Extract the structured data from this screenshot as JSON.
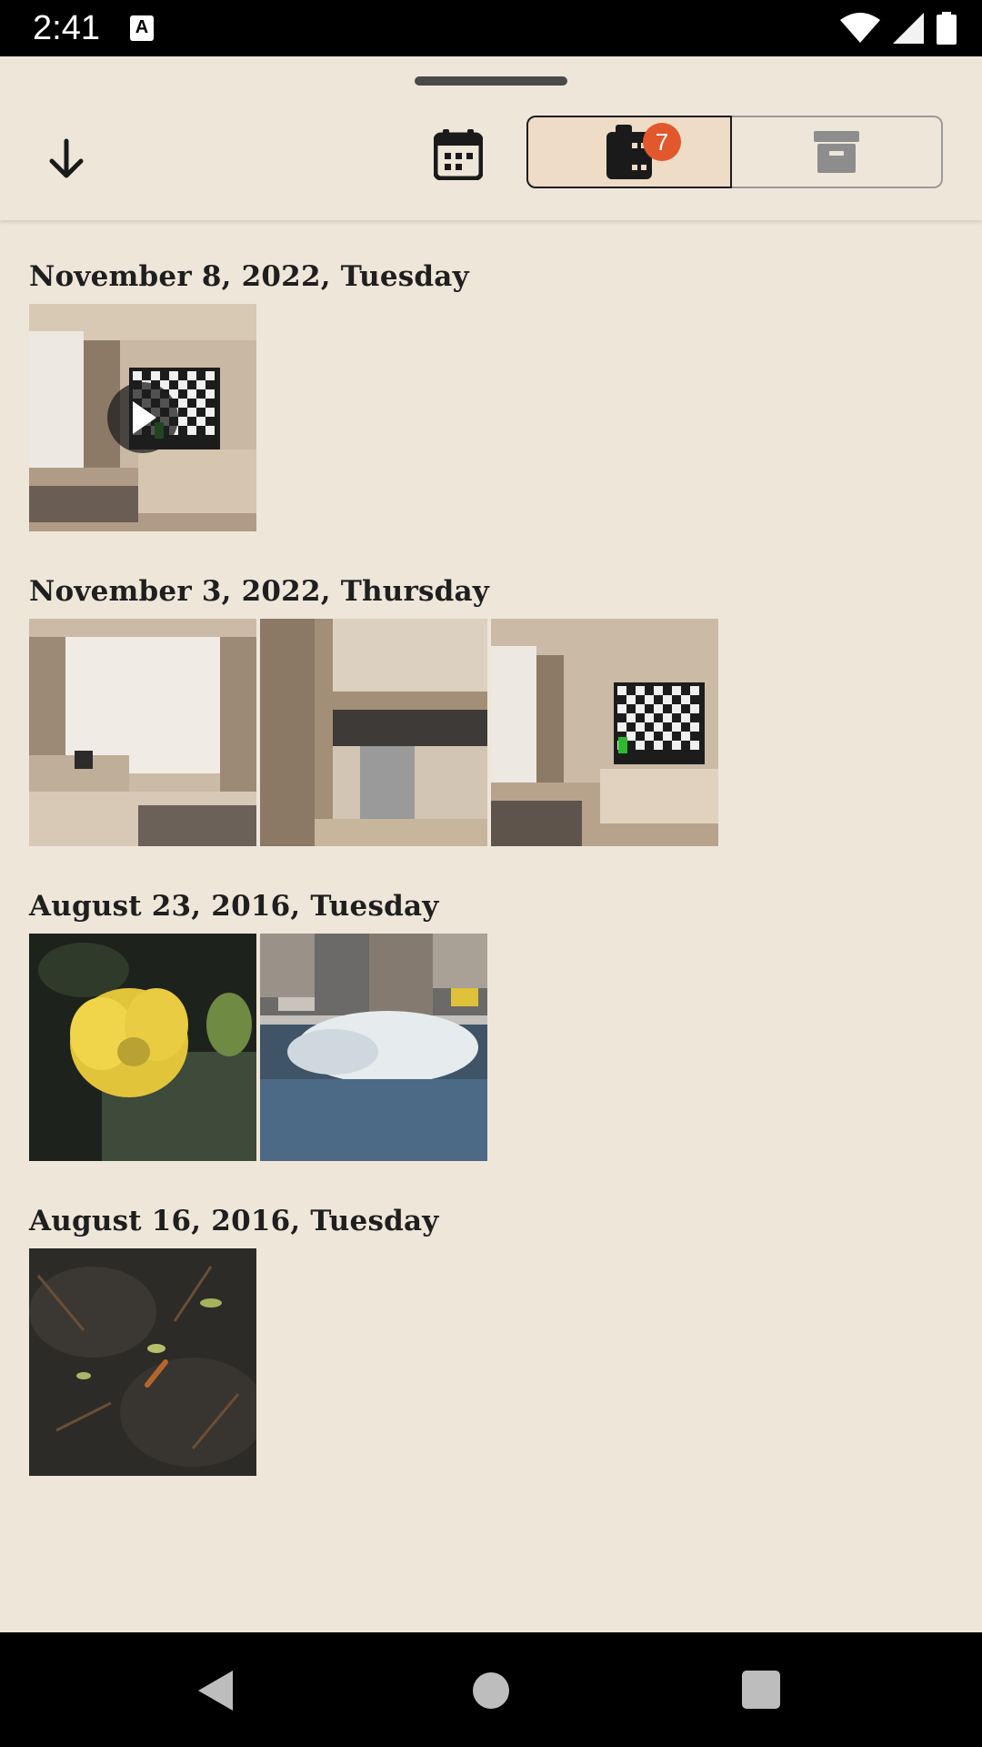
{
  "status_bar": {
    "time": "2:41",
    "icons": [
      "a-notification-icon",
      "wifi-icon",
      "cell-signal-icon",
      "battery-icon"
    ]
  },
  "toolbar": {
    "collapse_icon": "arrow-down-icon",
    "calendar_icon": "calendar-icon",
    "rolls_icon": "film-roll-icon",
    "rolls_badge": "7",
    "archive_icon": "archive-icon",
    "selected_segment": "rolls"
  },
  "groups": [
    {
      "date": "November 8, 2022, Tuesday",
      "photos": [
        {
          "subject": "living-room-tv",
          "video": true
        }
      ]
    },
    {
      "date": "November 3, 2022, Thursday",
      "photos": [
        {
          "subject": "living-room-window"
        },
        {
          "subject": "kitchen"
        },
        {
          "subject": "living-room-tv"
        }
      ]
    },
    {
      "date": "August 23, 2016, Tuesday",
      "photos": [
        {
          "subject": "yellow-cactus-flower"
        },
        {
          "subject": "waves-splashing"
        }
      ]
    },
    {
      "date": "August 16, 2016, Tuesday",
      "photos": [
        {
          "subject": "centipede-on-soil"
        }
      ]
    }
  ],
  "colors": {
    "background": "#efe6da",
    "selected_segment": "#efdcc6",
    "badge": "#e2572b",
    "text": "#1f1f1f"
  },
  "nav_bar": {
    "icons": [
      "back-icon",
      "home-icon",
      "recents-icon"
    ]
  }
}
